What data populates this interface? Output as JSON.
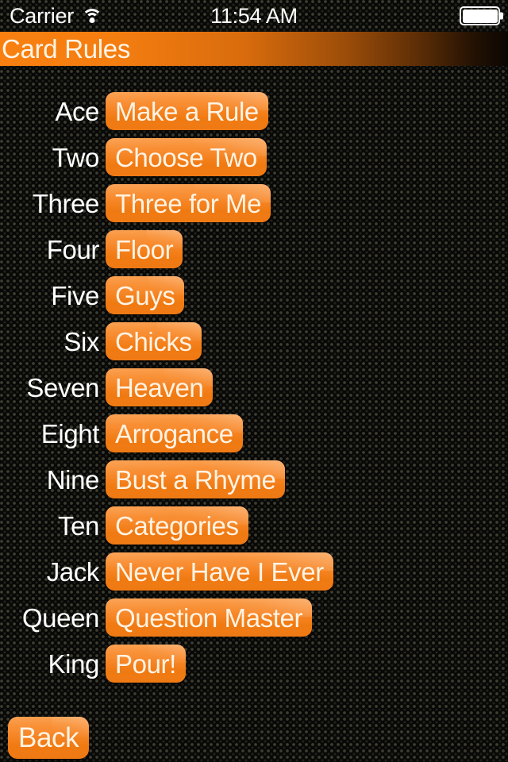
{
  "status_bar": {
    "carrier": "Carrier",
    "wifi_icon": "wifi-icon",
    "time": "11:54 AM",
    "battery_icon": "battery-full-icon",
    "battery_level_percent": 100
  },
  "navigation_bar": {
    "title": "Card Rules",
    "gradient_start_color": "#f98010",
    "gradient_end_color": "#0b0603",
    "title_color": "#fff4e6"
  },
  "theme": {
    "background_color": "#080807",
    "accent_color": "#f4821f",
    "button_top_color": "#fa9a45",
    "button_bottom_color": "#ef7a14",
    "label_color": "#ffffff",
    "button_text_color": "#fff3e4"
  },
  "rules": [
    {
      "rank": "Ace",
      "rule": "Make a Rule"
    },
    {
      "rank": "Two",
      "rule": "Choose Two"
    },
    {
      "rank": "Three",
      "rule": "Three for Me"
    },
    {
      "rank": "Four",
      "rule": "Floor"
    },
    {
      "rank": "Five",
      "rule": "Guys"
    },
    {
      "rank": "Six",
      "rule": "Chicks"
    },
    {
      "rank": "Seven",
      "rule": "Heaven"
    },
    {
      "rank": "Eight",
      "rule": "Arrogance"
    },
    {
      "rank": "Nine",
      "rule": "Bust a Rhyme"
    },
    {
      "rank": "Ten",
      "rule": "Categories"
    },
    {
      "rank": "Jack",
      "rule": "Never Have I Ever"
    },
    {
      "rank": "Queen",
      "rule": "Question Master"
    },
    {
      "rank": "King",
      "rule": "Pour!"
    }
  ],
  "footer": {
    "back_label": "Back"
  }
}
